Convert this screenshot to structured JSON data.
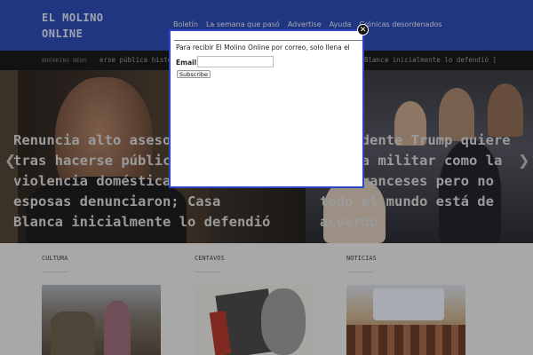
{
  "header": {
    "site_title_line1": "EL MOLINO",
    "site_title_line2": "ONLINE",
    "nav": [
      "Boletín",
      "La semana que pasó",
      "Advertise",
      "Ayuda",
      "Crónicas desordenados"
    ]
  },
  "breaking": {
    "label": "BREAKING NEWS",
    "ticker_left": "erse pública historia",
    "ticker_right": "Blanca inicialmente lo defendió ]"
  },
  "slider": {
    "left_title": [
      "Renuncia alto asesor",
      "tras hacerse pública",
      "violencia doméstica",
      "esposas denunciaron; Casa",
      "Blanca inicialmente lo defendió"
    ],
    "right_title": [
      "Presidente Trump quiere",
      "parada militar como la",
      "los franceses pero no",
      "todo el mundo está de",
      "acuerdo"
    ],
    "prev_icon": "chevron-left-icon",
    "next_icon": "chevron-right-icon"
  },
  "sections": [
    {
      "label": "CULTURA"
    },
    {
      "label": "CENTAVOS"
    },
    {
      "label": "NOTICIAS"
    }
  ],
  "modal": {
    "text": "Para recibir El Molino Online por correo, solo llena el",
    "email_label": "Email",
    "email_value": "",
    "subscribe_label": "Subscribe",
    "close_label": "✕"
  }
}
